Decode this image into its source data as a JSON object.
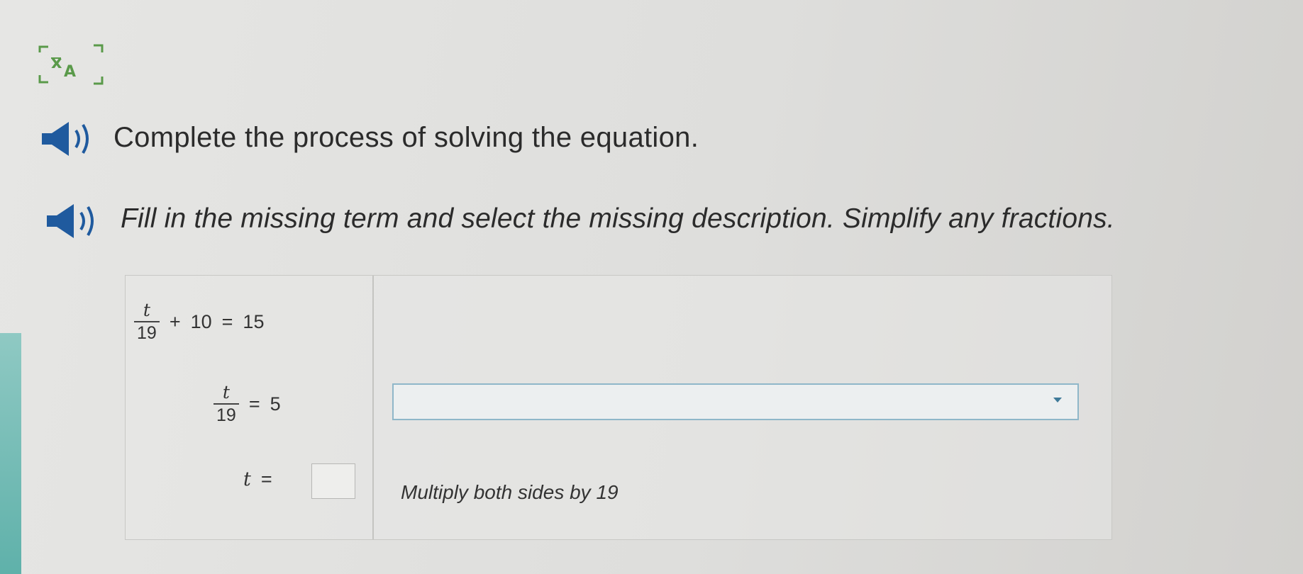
{
  "colors": {
    "accent_green": "#5a9a4a",
    "speaker_blue": "#1f5a9e",
    "left_strip": "#5fb1aa",
    "dropdown_border": "#8fb7c9"
  },
  "icons": {
    "translate": "translate-icon",
    "speaker": "speaker-icon",
    "caret": "chevron-down-icon"
  },
  "prompts": [
    "Complete the process of solving the equation.",
    "Fill in the missing term and select the missing description. Simplify any fractions."
  ],
  "steps": {
    "step1": {
      "numerator": "t",
      "denominator": "19",
      "op1": "+",
      "term": "10",
      "eq": "=",
      "rhs": "15"
    },
    "step2": {
      "numerator": "t",
      "denominator": "19",
      "eq": "=",
      "rhs": "5",
      "description_selected": ""
    },
    "step3": {
      "lhs": "t",
      "eq": "=",
      "answer_value": "",
      "description": "Multiply both sides by 19"
    }
  }
}
